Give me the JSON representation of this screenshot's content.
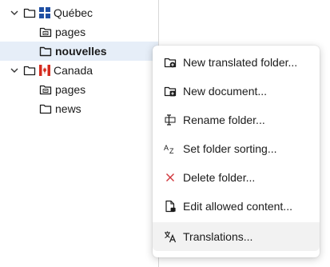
{
  "tree": {
    "items": [
      {
        "label": "Québec",
        "icon": "folder-icon",
        "badge": "quebec-flag-icon",
        "expanded": true
      },
      {
        "label": "pages",
        "icon": "pages-folder-icon"
      },
      {
        "label": "nouvelles",
        "icon": "folder-icon",
        "selected": true
      },
      {
        "label": "Canada",
        "icon": "folder-icon",
        "badge": "canada-flag-icon",
        "expanded": true
      },
      {
        "label": "pages",
        "icon": "pages-folder-icon"
      },
      {
        "label": "news",
        "icon": "folder-icon"
      }
    ]
  },
  "context_menu": {
    "items": [
      {
        "label": "New translated folder...",
        "icon": "new-translated-folder-icon"
      },
      {
        "label": "New document...",
        "icon": "new-document-icon"
      },
      {
        "label": "Rename folder...",
        "icon": "rename-icon"
      },
      {
        "label": "Set folder sorting...",
        "icon": "sort-az-icon"
      },
      {
        "label": "Delete folder...",
        "icon": "delete-x-icon"
      },
      {
        "label": "Edit allowed content...",
        "icon": "edit-allowed-content-icon"
      },
      {
        "label": "Translations...",
        "icon": "translations-icon",
        "hovered": true
      }
    ]
  },
  "colors": {
    "selected_row": "#e6eef8",
    "delete_icon": "#d0343a",
    "quebec_blue": "#1f4fa3",
    "canada_red": "#d52b1e",
    "menu_hover": "#f2f2f2"
  }
}
